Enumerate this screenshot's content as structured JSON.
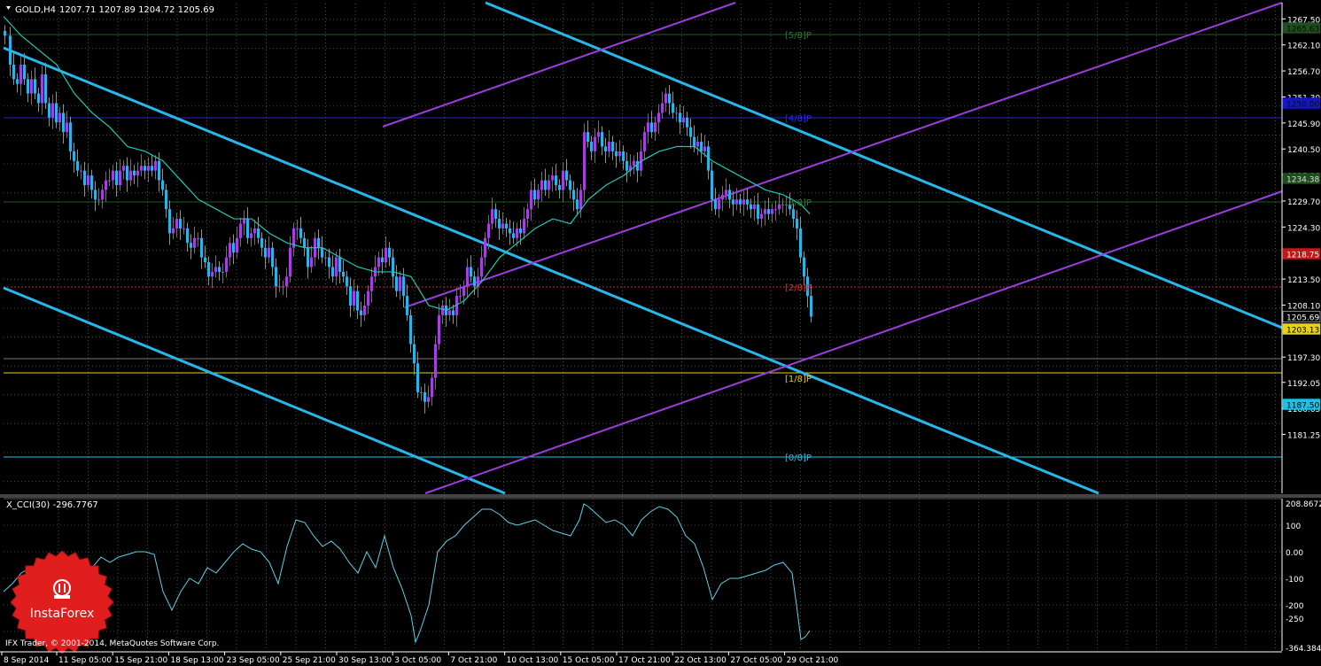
{
  "header": {
    "symbol_label": "GOLD,H4",
    "ohlc": "1207.71 1207.89 1204.72 1205.69"
  },
  "price_axis": {
    "ticks": [
      "1267.50",
      "1262.10",
      "1256.70",
      "1251.30",
      "1245.90",
      "1240.50",
      "1235.10",
      "1229.70",
      "1224.30",
      "1213.50",
      "1208.10",
      "1197.30",
      "1192.05",
      "1186.65",
      "1181.25"
    ]
  },
  "price_tags": [
    {
      "text": "1265.63",
      "color": "#1e4d1e",
      "text_color": "#0a0a0a"
    },
    {
      "text": "1250.00",
      "color": "#1515c8",
      "text_color": "#0a0a0a"
    },
    {
      "text": "1234.38",
      "color": "#1e4d1e",
      "text_color": "#d9d9d9"
    },
    {
      "text": "1218.75",
      "color": "#c81515",
      "text_color": "#ffffff"
    },
    {
      "text": "1205.69",
      "color": "#000000",
      "text_color": "#ffffff"
    },
    {
      "text": "1203.13",
      "color": "#e6d21e",
      "text_color": "#000000"
    },
    {
      "text": "1187.50",
      "color": "#19c3e6",
      "text_color": "#000000"
    }
  ],
  "murrey_labels": [
    {
      "text": "[5/8]P",
      "color": "#2d7a2d"
    },
    {
      "text": "[4/8]P",
      "color": "#2a2aff"
    },
    {
      "text": "[3/8]P",
      "color": "#2d7a2d"
    },
    {
      "text": "[2/8]P",
      "color": "#e62828"
    },
    {
      "text": "[1/8]P",
      "color": "#e6c81e"
    },
    {
      "text": "[0/8]P",
      "color": "#19c3e6"
    }
  ],
  "indicator": {
    "title": "X_CCI(30) -296.7767",
    "ticks": [
      "208.8672",
      "100",
      "0.00",
      "-100",
      "-200",
      "-250",
      "-364.3846"
    ]
  },
  "time_axis": {
    "labels": [
      "8 Sep 2014",
      "11 Sep 05:00",
      "15 Sep 21:00",
      "18 Sep 13:00",
      "23 Sep 05:00",
      "25 Sep 21:00",
      "30 Sep 13:00",
      "3 Oct 05:00",
      "7 Oct 21:00",
      "10 Oct 13:00",
      "15 Oct 05:00",
      "17 Oct 21:00",
      "22 Oct 13:00",
      "27 Oct 05:00",
      "29 Oct 21:00"
    ]
  },
  "footer": {
    "copyright": "IFX Trader, © 2001-2014, MetaQuotes Software Corp.",
    "logo_text": "InstaForex"
  },
  "chart_data": {
    "type": "candlestick",
    "symbol": "GOLD",
    "timeframe": "H4",
    "last_ohlc": {
      "open": 1207.71,
      "high": 1207.89,
      "low": 1204.72,
      "close": 1205.69
    },
    "y_range": [
      1180,
      1271
    ],
    "close_path": [
      [
        0,
        1264
      ],
      [
        6,
        1258
      ],
      [
        10,
        1255
      ],
      [
        14,
        1254
      ],
      [
        18,
        1258
      ],
      [
        22,
        1255
      ],
      [
        26,
        1252
      ],
      [
        30,
        1255
      ],
      [
        34,
        1252
      ],
      [
        38,
        1250
      ],
      [
        42,
        1256
      ],
      [
        46,
        1250
      ],
      [
        50,
        1247
      ],
      [
        54,
        1250
      ],
      [
        58,
        1246
      ],
      [
        62,
        1248
      ],
      [
        66,
        1244
      ],
      [
        70,
        1246
      ],
      [
        74,
        1240
      ],
      [
        78,
        1238
      ],
      [
        82,
        1236
      ],
      [
        86,
        1236
      ],
      [
        90,
        1233
      ],
      [
        94,
        1235
      ],
      [
        98,
        1232
      ],
      [
        102,
        1230
      ],
      [
        106,
        1230
      ],
      [
        110,
        1232
      ],
      [
        114,
        1234
      ],
      [
        118,
        1234
      ],
      [
        122,
        1236
      ],
      [
        126,
        1233
      ],
      [
        130,
        1236
      ],
      [
        134,
        1237
      ],
      [
        138,
        1234
      ],
      [
        142,
        1236
      ],
      [
        146,
        1235
      ],
      [
        150,
        1236
      ],
      [
        154,
        1237
      ],
      [
        158,
        1236
      ],
      [
        162,
        1237
      ],
      [
        166,
        1236
      ],
      [
        170,
        1238
      ],
      [
        174,
        1234
      ],
      [
        178,
        1232
      ],
      [
        182,
        1228
      ],
      [
        186,
        1223
      ],
      [
        190,
        1224
      ],
      [
        194,
        1226
      ],
      [
        198,
        1224
      ],
      [
        202,
        1224
      ],
      [
        206,
        1221
      ],
      [
        210,
        1220
      ],
      [
        214,
        1222
      ],
      [
        218,
        1222
      ],
      [
        222,
        1218
      ],
      [
        226,
        1217
      ],
      [
        230,
        1214
      ],
      [
        234,
        1215
      ],
      [
        238,
        1216
      ],
      [
        242,
        1215
      ],
      [
        246,
        1215
      ],
      [
        250,
        1218
      ],
      [
        254,
        1221
      ],
      [
        258,
        1219
      ],
      [
        262,
        1222
      ],
      [
        266,
        1225
      ],
      [
        270,
        1226
      ],
      [
        274,
        1222
      ],
      [
        278,
        1223
      ],
      [
        282,
        1224
      ],
      [
        286,
        1222
      ],
      [
        290,
        1220
      ],
      [
        294,
        1218
      ],
      [
        298,
        1220
      ],
      [
        302,
        1216
      ],
      [
        306,
        1212
      ],
      [
        310,
        1212
      ],
      [
        314,
        1212
      ],
      [
        318,
        1214
      ],
      [
        322,
        1220
      ],
      [
        326,
        1224
      ],
      [
        330,
        1224
      ],
      [
        334,
        1222
      ],
      [
        338,
        1220
      ],
      [
        342,
        1216
      ],
      [
        346,
        1218
      ],
      [
        350,
        1222
      ],
      [
        354,
        1220
      ],
      [
        358,
        1218
      ],
      [
        362,
        1218
      ],
      [
        366,
        1216
      ],
      [
        370,
        1214
      ],
      [
        374,
        1218
      ],
      [
        378,
        1215
      ],
      [
        382,
        1214
      ],
      [
        386,
        1212
      ],
      [
        390,
        1208
      ],
      [
        394,
        1211
      ],
      [
        398,
        1207
      ],
      [
        402,
        1206
      ],
      [
        406,
        1208
      ],
      [
        410,
        1211
      ],
      [
        414,
        1214
      ],
      [
        418,
        1216
      ],
      [
        422,
        1218
      ],
      [
        426,
        1217
      ],
      [
        430,
        1220
      ],
      [
        434,
        1218
      ],
      [
        438,
        1214
      ],
      [
        442,
        1211
      ],
      [
        446,
        1214
      ],
      [
        450,
        1210
      ],
      [
        454,
        1206
      ],
      [
        458,
        1200
      ],
      [
        462,
        1196
      ],
      [
        466,
        1190
      ],
      [
        470,
        1190
      ],
      [
        474,
        1188
      ],
      [
        478,
        1189
      ],
      [
        482,
        1193
      ],
      [
        486,
        1200
      ],
      [
        490,
        1206
      ],
      [
        494,
        1208
      ],
      [
        498,
        1206
      ],
      [
        502,
        1207
      ],
      [
        506,
        1206
      ],
      [
        510,
        1210
      ],
      [
        514,
        1210
      ],
      [
        518,
        1212
      ],
      [
        522,
        1216
      ],
      [
        526,
        1214
      ],
      [
        530,
        1212
      ],
      [
        534,
        1214
      ],
      [
        538,
        1218
      ],
      [
        542,
        1222
      ],
      [
        546,
        1225
      ],
      [
        550,
        1228
      ],
      [
        554,
        1226
      ],
      [
        558,
        1224
      ],
      [
        562,
        1225
      ],
      [
        566,
        1224
      ],
      [
        570,
        1223
      ],
      [
        574,
        1222
      ],
      [
        578,
        1224
      ],
      [
        582,
        1223
      ],
      [
        586,
        1226
      ],
      [
        590,
        1228
      ],
      [
        594,
        1232
      ],
      [
        598,
        1230
      ],
      [
        602,
        1232
      ],
      [
        606,
        1234
      ],
      [
        610,
        1232
      ],
      [
        614,
        1234
      ],
      [
        618,
        1235
      ],
      [
        622,
        1233
      ],
      [
        626,
        1232
      ],
      [
        630,
        1236
      ],
      [
        634,
        1234
      ],
      [
        638,
        1232
      ],
      [
        642,
        1230
      ],
      [
        646,
        1228
      ],
      [
        650,
        1232
      ],
      [
        654,
        1244
      ],
      [
        658,
        1242
      ],
      [
        662,
        1240
      ],
      [
        666,
        1243
      ],
      [
        670,
        1244
      ],
      [
        674,
        1241
      ],
      [
        678,
        1240
      ],
      [
        682,
        1242
      ],
      [
        686,
        1240
      ],
      [
        690,
        1239
      ],
      [
        694,
        1240
      ],
      [
        698,
        1238
      ],
      [
        702,
        1236
      ],
      [
        706,
        1237
      ],
      [
        710,
        1238
      ],
      [
        714,
        1236
      ],
      [
        718,
        1240
      ],
      [
        722,
        1244
      ],
      [
        726,
        1246
      ],
      [
        730,
        1244
      ],
      [
        734,
        1246
      ],
      [
        738,
        1248
      ],
      [
        742,
        1250
      ],
      [
        746,
        1252
      ],
      [
        750,
        1250
      ],
      [
        754,
        1248
      ],
      [
        758,
        1248
      ],
      [
        762,
        1246
      ],
      [
        766,
        1247
      ],
      [
        770,
        1245
      ],
      [
        774,
        1243
      ],
      [
        778,
        1241
      ],
      [
        782,
        1242
      ],
      [
        786,
        1240
      ],
      [
        790,
        1241
      ],
      [
        794,
        1236
      ],
      [
        798,
        1230
      ],
      [
        802,
        1228
      ],
      [
        806,
        1230
      ],
      [
        810,
        1231
      ],
      [
        814,
        1232
      ],
      [
        818,
        1230
      ],
      [
        822,
        1229
      ],
      [
        826,
        1230
      ],
      [
        830,
        1229
      ],
      [
        834,
        1230
      ],
      [
        838,
        1229
      ],
      [
        842,
        1228
      ],
      [
        846,
        1229
      ],
      [
        850,
        1226
      ],
      [
        854,
        1227
      ],
      [
        858,
        1228
      ],
      [
        862,
        1227
      ],
      [
        866,
        1228
      ],
      [
        870,
        1228
      ],
      [
        874,
        1229
      ],
      [
        878,
        1229
      ],
      [
        882,
        1229
      ],
      [
        886,
        1228
      ],
      [
        890,
        1226
      ],
      [
        894,
        1224
      ],
      [
        898,
        1218
      ],
      [
        902,
        1214
      ],
      [
        906,
        1210
      ],
      [
        910,
        1205.69
      ]
    ],
    "ma_path": [
      [
        0,
        1268
      ],
      [
        20,
        1264
      ],
      [
        40,
        1261
      ],
      [
        60,
        1258
      ],
      [
        80,
        1252
      ],
      [
        100,
        1248
      ],
      [
        120,
        1245
      ],
      [
        140,
        1241
      ],
      [
        160,
        1240
      ],
      [
        180,
        1238
      ],
      [
        200,
        1234
      ],
      [
        220,
        1230
      ],
      [
        240,
        1228
      ],
      [
        260,
        1226
      ],
      [
        280,
        1226
      ],
      [
        300,
        1223
      ],
      [
        320,
        1221
      ],
      [
        340,
        1220
      ],
      [
        360,
        1220
      ],
      [
        380,
        1218
      ],
      [
        400,
        1216
      ],
      [
        420,
        1215
      ],
      [
        440,
        1215
      ],
      [
        460,
        1214
      ],
      [
        480,
        1208
      ],
      [
        500,
        1207
      ],
      [
        520,
        1209
      ],
      [
        540,
        1213
      ],
      [
        560,
        1218
      ],
      [
        580,
        1221
      ],
      [
        600,
        1224
      ],
      [
        620,
        1226
      ],
      [
        640,
        1225
      ],
      [
        660,
        1230
      ],
      [
        680,
        1233
      ],
      [
        700,
        1235
      ],
      [
        720,
        1238
      ],
      [
        740,
        1240
      ],
      [
        760,
        1241
      ],
      [
        780,
        1241
      ],
      [
        800,
        1238
      ],
      [
        820,
        1236
      ],
      [
        840,
        1234
      ],
      [
        860,
        1232
      ],
      [
        880,
        1231
      ],
      [
        900,
        1229
      ],
      [
        910,
        1227
      ]
    ],
    "cci_path": [
      [
        0,
        -150
      ],
      [
        10,
        -120
      ],
      [
        20,
        -80
      ],
      [
        30,
        -60
      ],
      [
        40,
        -80
      ],
      [
        50,
        -100
      ],
      [
        60,
        -140
      ],
      [
        70,
        -200
      ],
      [
        80,
        -180
      ],
      [
        90,
        -120
      ],
      [
        100,
        -60
      ],
      [
        110,
        -20
      ],
      [
        120,
        -40
      ],
      [
        130,
        -20
      ],
      [
        140,
        -10
      ],
      [
        150,
        0
      ],
      [
        160,
        0
      ],
      [
        170,
        -10
      ],
      [
        180,
        -150
      ],
      [
        190,
        -220
      ],
      [
        200,
        -150
      ],
      [
        210,
        -100
      ],
      [
        220,
        -120
      ],
      [
        230,
        -60
      ],
      [
        240,
        -80
      ],
      [
        250,
        -40
      ],
      [
        260,
        0
      ],
      [
        270,
        30
      ],
      [
        280,
        10
      ],
      [
        290,
        0
      ],
      [
        300,
        -40
      ],
      [
        310,
        -120
      ],
      [
        320,
        20
      ],
      [
        330,
        120
      ],
      [
        340,
        110
      ],
      [
        350,
        60
      ],
      [
        360,
        20
      ],
      [
        370,
        40
      ],
      [
        380,
        10
      ],
      [
        390,
        -40
      ],
      [
        400,
        -80
      ],
      [
        410,
        0
      ],
      [
        420,
        -60
      ],
      [
        430,
        60
      ],
      [
        440,
        -60
      ],
      [
        450,
        -140
      ],
      [
        460,
        -240
      ],
      [
        465,
        -340
      ],
      [
        470,
        -300
      ],
      [
        480,
        -200
      ],
      [
        490,
        0
      ],
      [
        500,
        40
      ],
      [
        510,
        60
      ],
      [
        520,
        100
      ],
      [
        530,
        130
      ],
      [
        540,
        160
      ],
      [
        550,
        160
      ],
      [
        560,
        140
      ],
      [
        570,
        110
      ],
      [
        580,
        100
      ],
      [
        590,
        110
      ],
      [
        600,
        120
      ],
      [
        610,
        100
      ],
      [
        620,
        80
      ],
      [
        630,
        70
      ],
      [
        640,
        60
      ],
      [
        650,
        120
      ],
      [
        655,
        180
      ],
      [
        660,
        170
      ],
      [
        670,
        140
      ],
      [
        680,
        110
      ],
      [
        690,
        120
      ],
      [
        700,
        100
      ],
      [
        710,
        60
      ],
      [
        720,
        120
      ],
      [
        730,
        150
      ],
      [
        740,
        170
      ],
      [
        750,
        160
      ],
      [
        760,
        130
      ],
      [
        770,
        60
      ],
      [
        780,
        30
      ],
      [
        790,
        -60
      ],
      [
        800,
        -180
      ],
      [
        810,
        -120
      ],
      [
        820,
        -100
      ],
      [
        830,
        -100
      ],
      [
        840,
        -90
      ],
      [
        850,
        -80
      ],
      [
        860,
        -70
      ],
      [
        870,
        -50
      ],
      [
        880,
        -40
      ],
      [
        890,
        -80
      ],
      [
        895,
        -200
      ],
      [
        900,
        -330
      ],
      [
        905,
        -320
      ],
      [
        910,
        -296.78
      ]
    ]
  }
}
